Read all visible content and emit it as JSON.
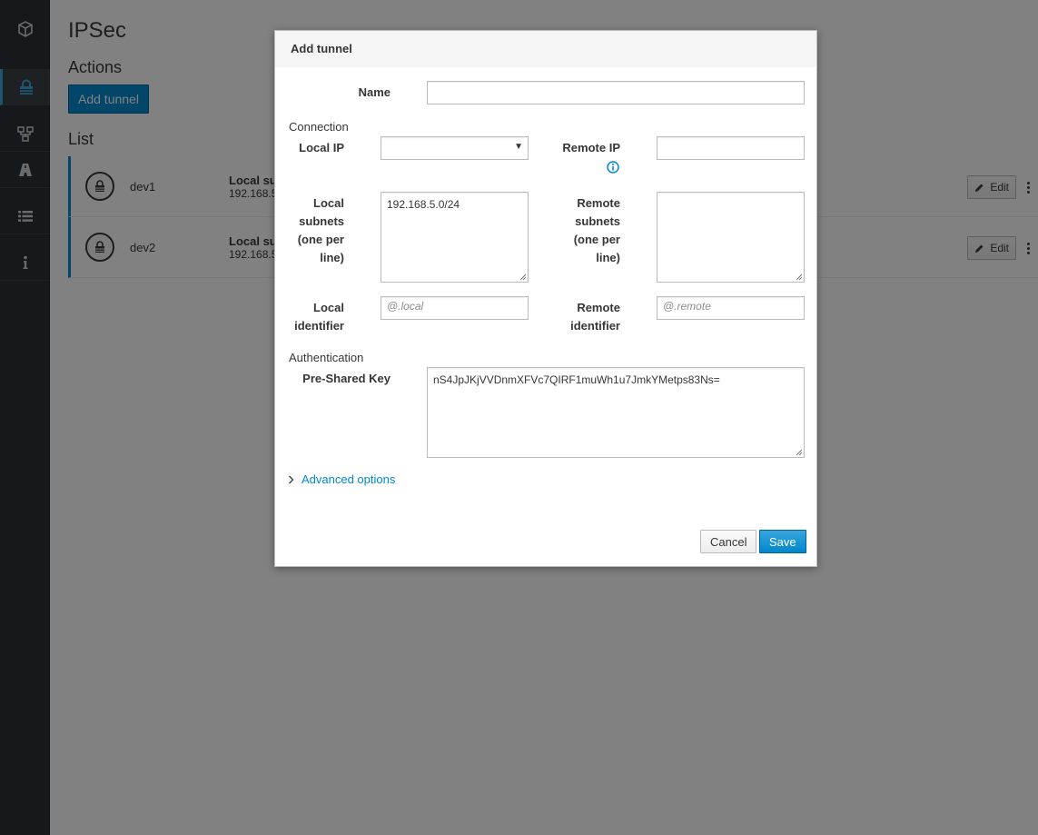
{
  "sidebar": {
    "items": [
      {
        "icon": "cube-icon"
      },
      {
        "icon": "lock-icon",
        "active": true
      },
      {
        "icon": "network-icon"
      },
      {
        "icon": "road-icon"
      },
      {
        "icon": "list-icon"
      },
      {
        "icon": "info-icon"
      }
    ]
  },
  "page": {
    "title": "IPSec",
    "actions_heading": "Actions",
    "add_tunnel_label": "Add tunnel",
    "list_heading": "List",
    "rows": [
      {
        "name": "dev1",
        "label": "Local sul",
        "value": "192.168.5",
        "edit_label": "Edit"
      },
      {
        "name": "dev2",
        "label": "Local sul",
        "value": "192.168.5",
        "edit_label": "Edit"
      }
    ]
  },
  "modal": {
    "title": "Add tunnel",
    "name_label": "Name",
    "name_value": "",
    "connection_heading": "Connection",
    "local_ip_label": "Local IP",
    "local_ip_value": "",
    "remote_ip_label": "Remote IP",
    "remote_ip_value": "",
    "local_subnets_label_lines": [
      "Local",
      "subnets",
      "(one per",
      "line)"
    ],
    "local_subnets_value": "192.168.5.0/24",
    "remote_subnets_label_lines": [
      "Remote",
      "subnets",
      "(one per",
      "line)"
    ],
    "remote_subnets_value": "",
    "local_identifier_label_lines": [
      "Local",
      "identifier"
    ],
    "local_identifier_placeholder": "@.local",
    "remote_identifier_label_lines": [
      "Remote",
      "identifier"
    ],
    "remote_identifier_placeholder": "@.remote",
    "authentication_heading": "Authentication",
    "psk_label": "Pre-Shared Key",
    "psk_value": "nS4JpJKjVVDnmXFVc7QIRF1muWh1u7JmkYMetps83Ns=",
    "advanced_options_label": "Advanced options",
    "cancel_label": "Cancel",
    "save_label": "Save"
  },
  "colors": {
    "accent": "#0088ce",
    "sidebar_bg": "#292e34",
    "info_icon": "#0088ce"
  }
}
